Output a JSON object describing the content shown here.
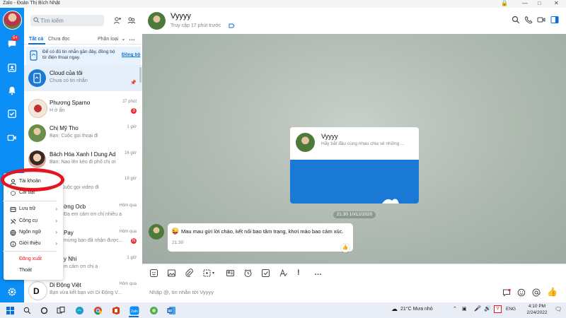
{
  "window": {
    "title": "Zalo - Đoàn Thị Bích Nhật"
  },
  "rail": {
    "chat_badge": "5+"
  },
  "search": {
    "placeholder": "Tìm kiếm"
  },
  "tabs": {
    "all": "Tất cả",
    "unread": "Chưa đọc",
    "classify": "Phân loại"
  },
  "sync_banner": {
    "text": "Để có đủ tin nhắn gần đây, đồng bộ từ điện thoại ngay.",
    "link": "Đồng bộ"
  },
  "conversations": [
    {
      "name": "Cloud của tôi",
      "preview": "Chưa có tin nhắn",
      "time": "",
      "badge": ""
    },
    {
      "name": "Phương Sparno",
      "preview": "H ở ẩn",
      "time": "27 phút",
      "badge": "3"
    },
    {
      "name": "Chị Mỹ Tho",
      "preview": "Bạn: Cuộc gọi thoại đi",
      "time": "1 giờ",
      "badge": ""
    },
    {
      "name": "Bách Hóa Xanh I Dung Ad",
      "preview": "Bạn: Nao lên kèo đi phố chị ơi",
      "time": "16 giờ",
      "badge": ""
    },
    {
      "name": "",
      "preview": "Cuộc gọi video đi",
      "time": "19 giờ",
      "badge": ""
    },
    {
      "name": "ờng Ocb",
      "preview": "Đạ em cảm ơn chị nhiều ạ",
      "time": "Hôm qua",
      "badge": ""
    },
    {
      "name": "Pay",
      "preview": "mừng bạn đã nhận được...",
      "time": "Hôm qua",
      "badge": "N"
    },
    {
      "name": "y Nhi",
      "preview": "m cảm ơn chị ạ",
      "time": "1 giờ",
      "badge": ""
    },
    {
      "name": "Di Động Việt",
      "preview": "Bạn vừa kết bạn với Di Động V...",
      "time": "Hôm qua",
      "badge": ""
    }
  ],
  "menu": {
    "account": "Tài khoản",
    "settings": "Cài đặt",
    "storage": "Lưu trữ",
    "tools": "Công cụ",
    "language": "Ngôn ngữ",
    "about": "Giới thiệu",
    "logout": "Đăng xuất",
    "quit": "Thoát"
  },
  "chat": {
    "name": "Vyyyy",
    "status": "Truy cập 17 phút trước",
    "card_name": "Vyyyy",
    "card_sub": "Hãy bắt đầu cùng nhau chia sẻ những ...",
    "date_pill": "21:30 10/12/2020",
    "message_text": "Mau mau gửi lời chào, kết nối bao tâm trạng, khơi mào bao cảm xúc.",
    "message_time": "21:30"
  },
  "input": {
    "placeholder": "Nhập @, tin nhắn tới Vyyyy"
  },
  "taskbar": {
    "weather": "21°C  Mưa nhỏ",
    "lang": "ENG",
    "time": "4:10 PM",
    "date": "2/24/2022"
  },
  "colors": {
    "rail": "#0b8ef5",
    "accent": "#0b6fd9",
    "badge": "#e8313c",
    "highlight": "#e3151f",
    "card_blue": "#1b79d6"
  }
}
